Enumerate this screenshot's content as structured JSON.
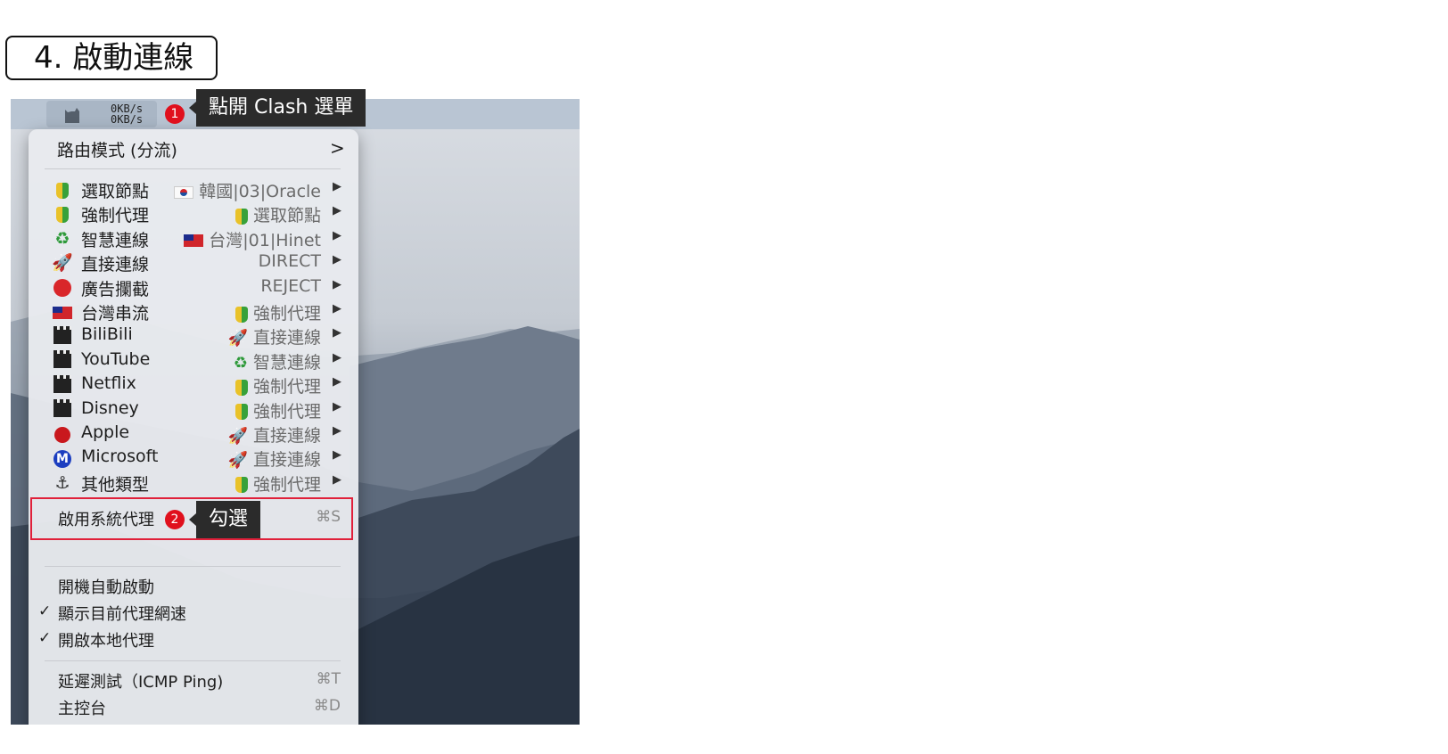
{
  "step_title": "4. 啟動連線",
  "menubar": {
    "speed_up": "0KB/s",
    "speed_down": "0KB/s"
  },
  "annotations": [
    {
      "number": "1",
      "text": "點開 Clash 選單"
    },
    {
      "number": "2",
      "text": "勾選"
    }
  ],
  "menu": {
    "mode_item": {
      "label": "路由模式 (分流)",
      "chevron": ">"
    },
    "proxy_groups": [
      {
        "name": "選取節點",
        "icon": "beginner-icon",
        "value": "韓國|03|Oracle",
        "value_icon": "flag-kr-icon"
      },
      {
        "name": "強制代理",
        "icon": "beginner-icon",
        "value": "選取節點",
        "value_icon": "beginner-icon"
      },
      {
        "name": "智慧連線",
        "icon": "recycle-icon",
        "value": "台灣|01|Hinet",
        "value_icon": "flag-tw-icon"
      },
      {
        "name": "直接連線",
        "icon": "rocket-icon",
        "value": "DIRECT",
        "value_icon": ""
      },
      {
        "name": "廣告攔截",
        "icon": "stop-sign-icon",
        "value": "REJECT",
        "value_icon": ""
      },
      {
        "name": "台灣串流",
        "icon": "flag-tw-icon",
        "value": "強制代理",
        "value_icon": "beginner-icon"
      },
      {
        "name": "BiliBili",
        "icon": "clapper-icon",
        "value": "直接連線",
        "value_icon": "rocket-icon"
      },
      {
        "name": "YouTube",
        "icon": "clapper-icon",
        "value": "智慧連線",
        "value_icon": "recycle-icon"
      },
      {
        "name": "Netflix",
        "icon": "clapper-icon",
        "value": "強制代理",
        "value_icon": "beginner-icon"
      },
      {
        "name": "Disney",
        "icon": "clapper-icon",
        "value": "強制代理",
        "value_icon": "beginner-icon"
      },
      {
        "name": "Apple",
        "icon": "apple-icon",
        "value": "直接連線",
        "value_icon": "rocket-icon"
      },
      {
        "name": "Microsoft",
        "icon": "m-circle-icon",
        "value": "直接連線",
        "value_icon": "rocket-icon"
      },
      {
        "name": "其他類型",
        "icon": "anchor-icon",
        "value": "強制代理",
        "value_icon": "beginner-icon"
      }
    ],
    "system_proxy": {
      "label": "啟用系統代理",
      "shortcut": "⌘S"
    },
    "launch_at_login": {
      "label": "開機自動啟動"
    },
    "show_speed": {
      "label": "顯示目前代理網速",
      "check": "✓"
    },
    "local_proxy": {
      "label": "開啟本地代理",
      "check": "✓"
    },
    "latency_test": {
      "label": "延遲測試（ICMP Ping)",
      "shortcut": "⌘T"
    },
    "dashboard": {
      "label": "主控台",
      "shortcut": "⌘D"
    }
  },
  "colors": {
    "highlight": "#e0203a",
    "badge": "#e0101d",
    "tooltip": "#2b2b2b"
  }
}
